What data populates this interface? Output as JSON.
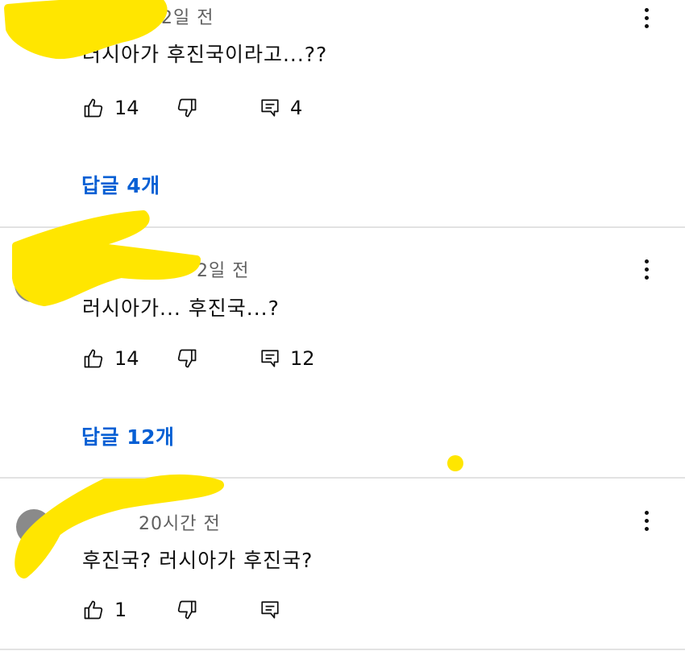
{
  "comments": [
    {
      "time": "2일 전",
      "text": "러시아가 후진국이라고...??",
      "likes": "14",
      "reply_count": "4",
      "replies_link": "답글 4개"
    },
    {
      "time": "2일 전",
      "text": "러시아가... 후진국...?",
      "likes": "14",
      "reply_count": "12",
      "replies_link": "답글 12개"
    },
    {
      "time": "20시간 전",
      "text": "후진국? 러시아가 후진국?",
      "likes": "1",
      "reply_count": ""
    }
  ],
  "icons": {
    "like": "thumb-up-icon",
    "dislike": "thumb-down-icon",
    "reply": "comment-icon",
    "more": "more-vert-icon"
  },
  "colors": {
    "redaction": "#ffe600",
    "link": "#065fd4",
    "meta": "#606060"
  }
}
